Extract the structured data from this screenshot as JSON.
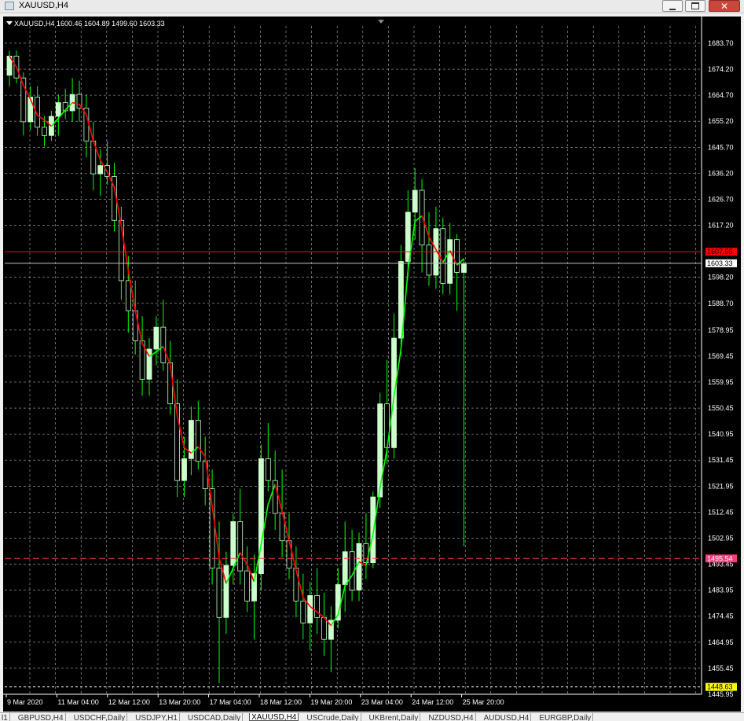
{
  "window": {
    "title": "XAUUSD,H4",
    "minimize_glyph": "minimize-icon",
    "maximize_glyph": "maximize-icon",
    "close_glyph": "✕"
  },
  "chart_header": {
    "symbol_info": "XAUUSD,H4  1600.46 1604.89 1499.60 1603.33"
  },
  "tabs": [
    {
      "label": "l1",
      "active": false
    },
    {
      "label": "GBPUSD,H4",
      "active": false
    },
    {
      "label": "USDCHF,Daily",
      "active": false
    },
    {
      "label": "USDJPY,H1",
      "active": false
    },
    {
      "label": "USDCAD,Daily",
      "active": false
    },
    {
      "label": "XAUUSD,H4",
      "active": true
    },
    {
      "label": "USCrude,Daily",
      "active": false
    },
    {
      "label": "UKBrent,Daily",
      "active": false
    },
    {
      "label": "NZDUSD,H4",
      "active": false
    },
    {
      "label": "AUDUSD,H4",
      "active": false
    },
    {
      "label": "EURGBP,Daily",
      "active": false
    }
  ],
  "colors": {
    "background": "#000000",
    "grid": "#b0b0b0",
    "bull_candle": "#ccffcc",
    "bear_candle": "#000000",
    "wick": "#00ff00",
    "ma_up": "#00ff00",
    "ma_down": "#ff0000",
    "resistance_line": "#ff0000",
    "support_line": "#ff3b3b",
    "current_price_line": "#c0c0c0"
  },
  "chart_data": {
    "type": "candlestick",
    "symbol": "XAUUSD",
    "timeframe": "H4",
    "ylim": [
      1445.95,
      1690.0
    ],
    "y_ticks": [
      "1683.70",
      "1674.20",
      "1664.70",
      "1655.20",
      "1645.70",
      "1636.20",
      "1626.70",
      "1617.20",
      "1598.20",
      "1588.70",
      "1578.95",
      "1569.45",
      "1559.95",
      "1550.45",
      "1540.95",
      "1531.45",
      "1521.95",
      "1512.45",
      "1502.95",
      "1493.45",
      "1483.95",
      "1474.45",
      "1464.95",
      "1455.45",
      "1445.95"
    ],
    "x_ticks": [
      "9 Mar 2020",
      "11 Mar 04:00",
      "12 Mar 12:00",
      "13 Mar 20:00",
      "17 Mar 04:00",
      "18 Mar 12:00",
      "19 Mar 20:00",
      "23 Mar 04:00",
      "24 Mar 12:00",
      "25 Mar 20:00"
    ],
    "price_labels": [
      {
        "value": 1607.55,
        "text": "1607.55",
        "kind": "resistance"
      },
      {
        "value": 1603.33,
        "text": "1603.33",
        "kind": "current"
      },
      {
        "value": 1495.54,
        "text": "1495.54",
        "kind": "support"
      },
      {
        "value": 1448.63,
        "text": "1448.63",
        "kind": "low"
      }
    ],
    "ohlc": [
      [
        1672,
        1681,
        1668,
        1679
      ],
      [
        1679,
        1681,
        1669,
        1671
      ],
      [
        1671,
        1673,
        1650,
        1655
      ],
      [
        1655,
        1668,
        1652,
        1664
      ],
      [
        1664,
        1668,
        1650,
        1653
      ],
      [
        1653,
        1657,
        1646,
        1650
      ],
      [
        1650,
        1659,
        1648,
        1657
      ],
      [
        1657,
        1665,
        1650,
        1662
      ],
      [
        1662,
        1667,
        1656,
        1659
      ],
      [
        1659,
        1671,
        1655,
        1665
      ],
      [
        1665,
        1670,
        1655,
        1660
      ],
      [
        1660,
        1665,
        1642,
        1648
      ],
      [
        1648,
        1655,
        1630,
        1636
      ],
      [
        1636,
        1645,
        1628,
        1639
      ],
      [
        1639,
        1648,
        1632,
        1635
      ],
      [
        1635,
        1640,
        1615,
        1619
      ],
      [
        1619,
        1624,
        1590,
        1597
      ],
      [
        1597,
        1606,
        1578,
        1586
      ],
      [
        1586,
        1597,
        1570,
        1575
      ],
      [
        1575,
        1584,
        1555,
        1561
      ],
      [
        1561,
        1576,
        1555,
        1572
      ],
      [
        1572,
        1584,
        1566,
        1580
      ],
      [
        1580,
        1590,
        1564,
        1567
      ],
      [
        1567,
        1575,
        1548,
        1552
      ],
      [
        1552,
        1561,
        1518,
        1524
      ],
      [
        1524,
        1540,
        1518,
        1532
      ],
      [
        1532,
        1551,
        1526,
        1546
      ],
      [
        1546,
        1553,
        1528,
        1531
      ],
      [
        1531,
        1540,
        1515,
        1521
      ],
      [
        1521,
        1528,
        1486,
        1492
      ],
      [
        1492,
        1509,
        1450,
        1474
      ],
      [
        1474,
        1498,
        1468,
        1493
      ],
      [
        1493,
        1512,
        1486,
        1509
      ],
      [
        1509,
        1521,
        1486,
        1491
      ],
      [
        1491,
        1500,
        1476,
        1480
      ],
      [
        1480,
        1497,
        1466,
        1490
      ],
      [
        1490,
        1537,
        1484,
        1532
      ],
      [
        1532,
        1545,
        1520,
        1524
      ],
      [
        1524,
        1535,
        1506,
        1512
      ],
      [
        1512,
        1528,
        1496,
        1502
      ],
      [
        1502,
        1512,
        1488,
        1492
      ],
      [
        1492,
        1500,
        1474,
        1480
      ],
      [
        1480,
        1490,
        1466,
        1472
      ],
      [
        1472,
        1487,
        1462,
        1482
      ],
      [
        1482,
        1492,
        1468,
        1474
      ],
      [
        1474,
        1483,
        1460,
        1466
      ],
      [
        1466,
        1478,
        1454,
        1473
      ],
      [
        1473,
        1492,
        1470,
        1486
      ],
      [
        1486,
        1509,
        1476,
        1498
      ],
      [
        1498,
        1506,
        1480,
        1484
      ],
      [
        1484,
        1505,
        1480,
        1501
      ],
      [
        1501,
        1512,
        1488,
        1494
      ],
      [
        1494,
        1520,
        1492,
        1518
      ],
      [
        1518,
        1556,
        1514,
        1552
      ],
      [
        1552,
        1568,
        1530,
        1536
      ],
      [
        1536,
        1585,
        1532,
        1576
      ],
      [
        1576,
        1610,
        1570,
        1604
      ],
      [
        1604,
        1630,
        1598,
        1622
      ],
      [
        1622,
        1638,
        1612,
        1630
      ],
      [
        1630,
        1634,
        1600,
        1610
      ],
      [
        1610,
        1622,
        1595,
        1599
      ],
      [
        1599,
        1624,
        1594,
        1616
      ],
      [
        1616,
        1620,
        1592,
        1596
      ],
      [
        1596,
        1618,
        1592,
        1612
      ],
      [
        1612,
        1614,
        1586,
        1600
      ],
      [
        1600,
        1605,
        1500,
        1603
      ]
    ]
  }
}
